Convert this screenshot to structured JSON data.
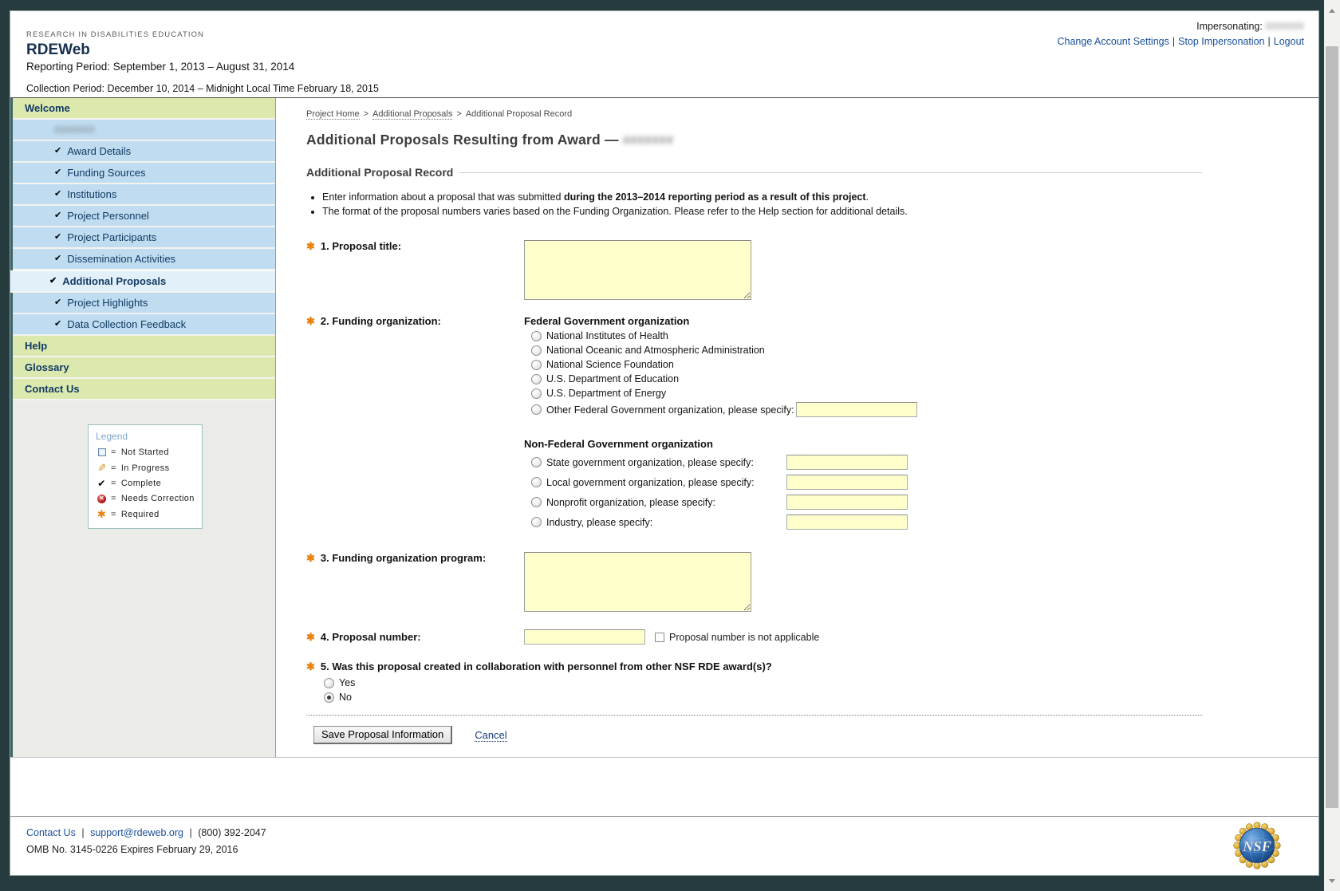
{
  "colors": {
    "frame_dark": "#253B3D",
    "sidebar_header_green": "#DCE9AE",
    "sidebar_item_blue": "#BFDCF1",
    "sidebar_selected_blue": "#E2F0FA",
    "field_yellow": "#FFFFCC",
    "link_blue": "#1A4F9C",
    "required_orange": "#E8820C"
  },
  "icons": {
    "check_glyph": "✔",
    "pencil_glyph": "✎",
    "x_glyph": "✕",
    "required_glyph": "✱"
  },
  "header": {
    "eyebrow": "RESEARCH IN DISABILITIES EDUCATION",
    "app_name": "RDEWeb",
    "reporting_period": "Reporting Period: September 1, 2013 – August 31, 2014",
    "collection_period": "Collection Period: December 10, 2014 – Midnight Local Time February 18, 2015",
    "impersonating_label": "Impersonating:",
    "impersonating_value_redacted": "#######",
    "separator": "|",
    "links": [
      {
        "label": "Change Account Settings"
      },
      {
        "label": "Stop Impersonation"
      },
      {
        "label": "Logout"
      }
    ]
  },
  "sidebar": {
    "welcome": "Welcome",
    "award_number_redacted": "#######",
    "items": [
      {
        "label": "Award Details",
        "status": "complete"
      },
      {
        "label": "Funding Sources",
        "status": "complete"
      },
      {
        "label": "Institutions",
        "status": "complete"
      },
      {
        "label": "Project Personnel",
        "status": "complete"
      },
      {
        "label": "Project Participants",
        "status": "complete"
      },
      {
        "label": "Dissemination Activities",
        "status": "complete"
      },
      {
        "label": "Additional Proposals",
        "status": "complete",
        "selected": true
      },
      {
        "label": "Project Highlights",
        "status": "complete"
      },
      {
        "label": "Data Collection Feedback",
        "status": "complete"
      }
    ],
    "help": "Help",
    "glossary": "Glossary",
    "contact_us": "Contact Us",
    "legend": {
      "title": "Legend",
      "equals": "=",
      "items": [
        {
          "icon": "not-started-square",
          "label": "Not Started"
        },
        {
          "icon": "in-progress-pencil",
          "label": "In Progress"
        },
        {
          "icon": "complete-check",
          "label": "Complete"
        },
        {
          "icon": "needs-correction-x",
          "label": "Needs Correction"
        },
        {
          "icon": "required-asterisk",
          "label": "Required"
        }
      ]
    }
  },
  "breadcrumb": {
    "separator": ">",
    "items": [
      {
        "label": "Project Home",
        "link": true
      },
      {
        "label": "Additional Proposals",
        "link": true
      },
      {
        "label": "Additional Proposal Record",
        "link": false
      }
    ]
  },
  "page": {
    "title_prefix": "Additional Proposals Resulting from Award —",
    "award_number_redacted": "#######",
    "section_title": "Additional Proposal Record",
    "bullets": {
      "b1_pre": "Enter information about a proposal that was submitted ",
      "b1_bold": "during the 2013–2014 reporting period as a result of this project",
      "b1_post": ".",
      "b2": "The format of the proposal numbers varies based on the Funding Organization. Please refer to the Help section for additional details."
    }
  },
  "form": {
    "q1": {
      "label": "1. Proposal title:",
      "value": ""
    },
    "q2": {
      "label": "2. Funding organization:",
      "federal_heading": "Federal Government organization",
      "federal_options": [
        "National Institutes of Health",
        "National Oceanic and Atmospheric Administration",
        "National Science Foundation",
        "U.S. Department of Education",
        "U.S. Department of Energy"
      ],
      "federal_other_label": "Other Federal Government organization, please specify:",
      "federal_other_value": "",
      "nonfederal_heading": "Non-Federal Government organization",
      "nonfederal_options": [
        {
          "label": "State government organization, please specify:",
          "value": ""
        },
        {
          "label": "Local government organization, please specify:",
          "value": ""
        },
        {
          "label": "Nonprofit organization, please specify:",
          "value": ""
        },
        {
          "label": "Industry, please specify:",
          "value": ""
        }
      ],
      "selected": null
    },
    "q3": {
      "label": "3. Funding organization program:",
      "value": ""
    },
    "q4": {
      "label": "4. Proposal number:",
      "value": "",
      "checkbox_label": "Proposal number is not applicable",
      "checkbox_checked": false
    },
    "q5": {
      "label": "5. Was this proposal created in collaboration with personnel from other NSF RDE award(s)?",
      "options": [
        "Yes",
        "No"
      ],
      "selected": "No"
    },
    "actions": {
      "save": "Save Proposal Information",
      "cancel": "Cancel"
    }
  },
  "footer": {
    "contact_link": "Contact Us",
    "email_link": "support@rdeweb.org",
    "phone": "(800) 392-2047",
    "separator": "|",
    "omb": "OMB No. 3145-0226 Expires February 29, 2016",
    "nsf_logo_text": "NSF"
  }
}
